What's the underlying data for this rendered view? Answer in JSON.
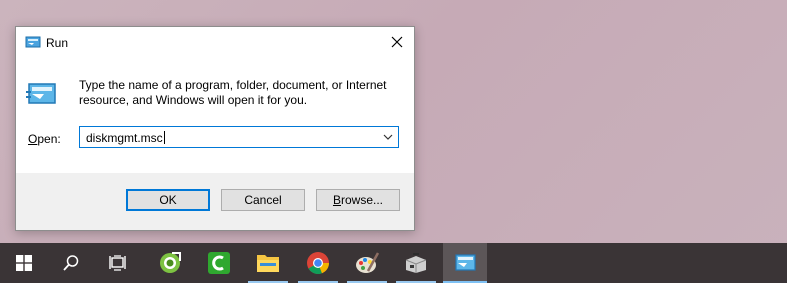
{
  "dialog": {
    "title": "Run",
    "description": "Type the name of a program, folder, document, or Internet resource, and Windows will open it for you.",
    "open_label_accel": "O",
    "open_label_rest": "pen:",
    "command_value": "diskmgmt.msc",
    "buttons": {
      "ok": "OK",
      "cancel": "Cancel",
      "browse_accel": "B",
      "browse_rest": "rowse..."
    }
  },
  "taskbar": {
    "items": [
      {
        "name": "start-icon"
      },
      {
        "name": "search-icon"
      },
      {
        "name": "task-view-icon"
      },
      {
        "name": "greenshot-icon"
      },
      {
        "name": "camtasia-icon"
      },
      {
        "name": "file-explorer-icon"
      },
      {
        "name": "chrome-icon"
      },
      {
        "name": "paint-icon"
      },
      {
        "name": "tool-box-icon"
      },
      {
        "name": "run-app-icon"
      }
    ]
  },
  "colors": {
    "accent": "#0078d7",
    "taskbar": "#3a3436",
    "desktop": "#c8b0ba"
  }
}
